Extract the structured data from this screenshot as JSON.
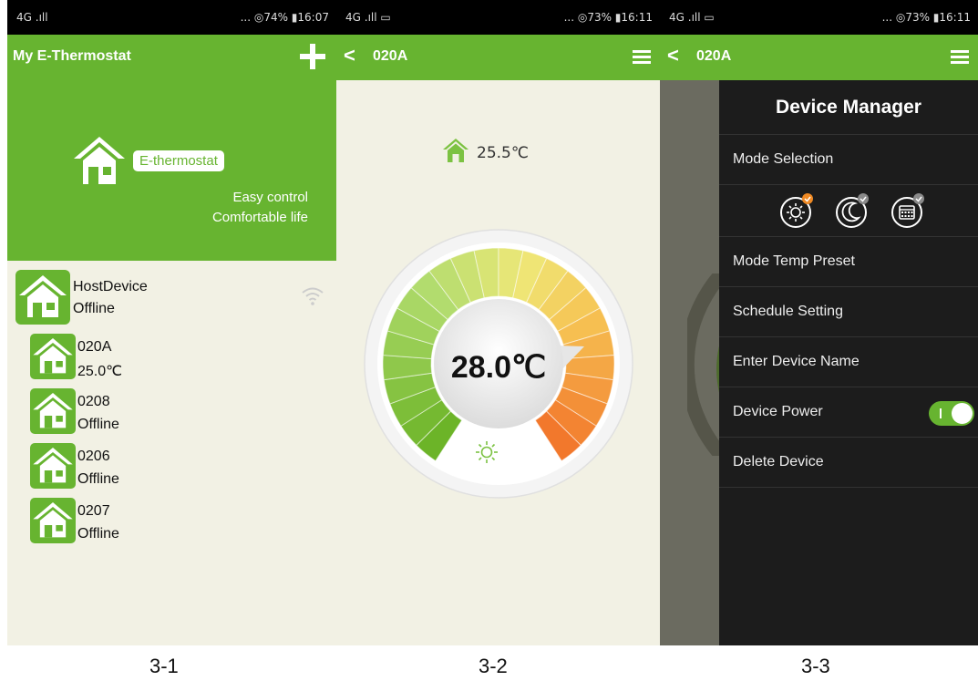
{
  "screen1": {
    "status_left": "4G .ıll",
    "status_right": "... ◎74% ▮16:07",
    "title": "My E-Thermostat",
    "brand": "E-thermostat",
    "slogan_line1": "Easy control",
    "slogan_line2": "Comfortable life",
    "devices": [
      {
        "name": "HostDevice",
        "status": "Offline"
      },
      {
        "name": "020A",
        "status": "25.0℃"
      },
      {
        "name": "0208",
        "status": "Offline"
      },
      {
        "name": "0206",
        "status": "Offline"
      },
      {
        "name": "0207",
        "status": "Offline"
      }
    ]
  },
  "screen2": {
    "status_left": "4G .ıll ▭",
    "status_right": "... ◎73% ▮16:11",
    "back": "<",
    "title": "020A",
    "room_temp": "25.5℃",
    "set_temp": "28.0℃"
  },
  "screen3": {
    "status_left": "4G .ıll ▭",
    "status_right": "... ◎73% ▮16:11",
    "back": "<",
    "title": "020A",
    "drawer_title": "Device Manager",
    "items": {
      "mode_selection": "Mode Selection",
      "mode_temp_preset": "Mode Temp Preset",
      "schedule_setting": "Schedule Setting",
      "enter_device_name": "Enter Device Name",
      "device_power": "Device Power",
      "delete_device": "Delete Device"
    },
    "device_power_on": true
  },
  "captions": [
    "3-1",
    "3-2",
    "3-3"
  ],
  "colors": {
    "accent": "#67b430",
    "background": "#f2f1e4",
    "drawer": "#1c1c1c",
    "badge": "#f08a24"
  }
}
